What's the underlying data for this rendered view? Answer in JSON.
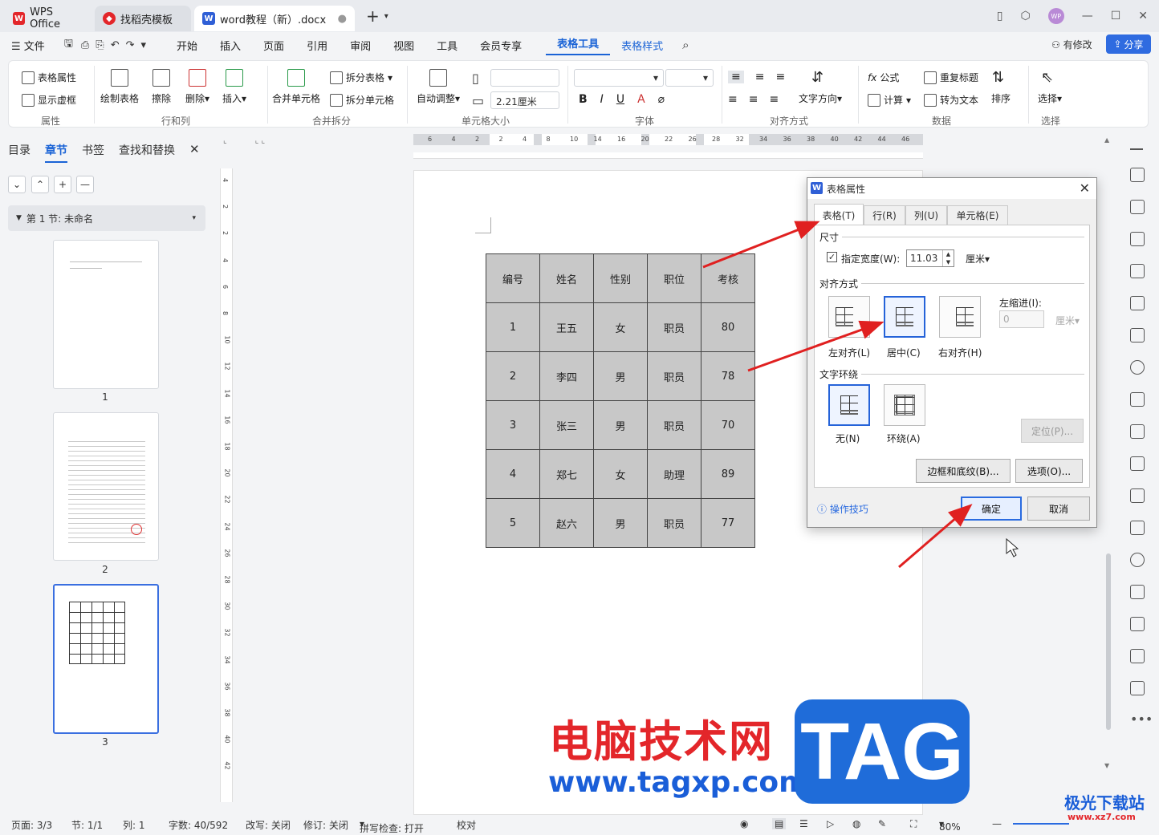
{
  "tabs": [
    {
      "label": "WPS Office"
    },
    {
      "label": "找稻壳模板"
    },
    {
      "label": "word教程（新）.docx"
    }
  ],
  "menu": {
    "file": "文件",
    "items": [
      "开始",
      "插入",
      "页面",
      "引用",
      "审阅",
      "视图",
      "工具",
      "会员专享"
    ],
    "table_tools": "表格工具",
    "table_style": "表格样式",
    "modified": "有修改",
    "share": "分享"
  },
  "ribbon": {
    "table_props": "表格属性",
    "show_grid": "显示虚框",
    "grp_props": "属性",
    "draw_table": "绘制表格",
    "erase": "擦除",
    "delete": "删除",
    "insert": "插入",
    "grp_rowcol": "行和列",
    "merge": "合并单元格",
    "split_table": "拆分表格",
    "split_cell": "拆分单元格",
    "grp_merge": "合并拆分",
    "auto_adjust": "自动调整",
    "height_value": "2.21厘米",
    "grp_cellsize": "单元格大小",
    "grp_font": "字体",
    "text_dir": "文字方向",
    "grp_align": "对齐方式",
    "formula": "公式",
    "calc": "计算",
    "repeat_title": "重复标题",
    "to_text": "转为文本",
    "sort": "排序",
    "grp_data": "数据",
    "select": "选择",
    "grp_select": "选择"
  },
  "leftpane": {
    "tabs": [
      "目录",
      "章节",
      "书签",
      "查找和替换"
    ],
    "section": "第 1 节: 未命名",
    "pages": [
      "1",
      "2",
      "3"
    ]
  },
  "ruler": {
    "h_ticks": [
      "6",
      "4",
      "2",
      "2",
      "4",
      "8",
      "10",
      "14",
      "16",
      "20",
      "22",
      "26",
      "28",
      "32",
      "34",
      "36",
      "38",
      "40",
      "42",
      "44",
      "46"
    ],
    "v_ticks": [
      "4",
      "2",
      "2",
      "4",
      "6",
      "8",
      "10",
      "12",
      "14",
      "16",
      "18",
      "20",
      "22",
      "24",
      "26",
      "28",
      "30",
      "32",
      "34",
      "36",
      "38",
      "40",
      "42"
    ]
  },
  "table": {
    "headers": [
      "编号",
      "姓名",
      "性别",
      "职位",
      "考核"
    ],
    "rows": [
      [
        "1",
        "王五",
        "女",
        "职员",
        "80"
      ],
      [
        "2",
        "李四",
        "男",
        "职员",
        "78"
      ],
      [
        "3",
        "张三",
        "男",
        "职员",
        "70"
      ],
      [
        "4",
        "郑七",
        "女",
        "助理",
        "89"
      ],
      [
        "5",
        "赵六",
        "男",
        "职员",
        "77"
      ]
    ]
  },
  "dialog": {
    "title": "表格属性",
    "tabs": [
      "表格(T)",
      "行(R)",
      "列(U)",
      "单元格(E)"
    ],
    "size_label": "尺寸",
    "width_label": "指定宽度(W):",
    "width_value": "11.03",
    "width_unit": "厘米",
    "align_label": "对齐方式",
    "align_left": "左对齐(L)",
    "align_center": "居中(C)",
    "align_right": "右对齐(H)",
    "indent_label": "左缩进(I):",
    "indent_value": "0",
    "indent_unit": "厘米",
    "wrap_label": "文字环绕",
    "wrap_none": "无(N)",
    "wrap_around": "环绕(A)",
    "position_btn": "定位(P)...",
    "border_btn": "边框和底纹(B)...",
    "options_btn": "选项(O)...",
    "tips": "操作技巧",
    "ok": "确定",
    "cancel": "取消"
  },
  "status": {
    "page": "页面: 3/3",
    "section": "节: 1/1",
    "col": "列: 1",
    "words": "字数: 40/592",
    "revise": "改写: 关闭",
    "track": "修订: 关闭",
    "spell": "拼写检查: 打开",
    "proof": "校对",
    "zoom": "80%"
  },
  "watermark": {
    "cn": "电脑技术网",
    "url": "www.tagxp.com",
    "tag": "TAG",
    "jg": "极光下载站",
    "jg_url": "www.xz7.com"
  },
  "colors": {
    "accent": "#1a63d6",
    "arrow": "#e02020"
  }
}
